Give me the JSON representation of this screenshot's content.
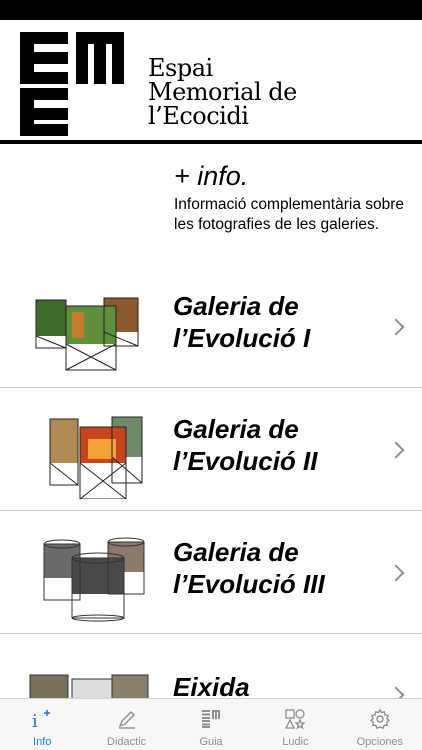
{
  "header": {
    "logo_line1": "Espai",
    "logo_line2": "Memorial de",
    "logo_line3": "l’Ecocidi"
  },
  "info": {
    "title": "+ info.",
    "description": "Informació complementària sobre les fotografies de les galeries."
  },
  "galleries": [
    {
      "title_line1": "Galeria de",
      "title_line2": "l’Evolució I"
    },
    {
      "title_line1": "Galeria de",
      "title_line2": "l’Evolució II"
    },
    {
      "title_line1": "Galeria de",
      "title_line2": "l’Evolució III"
    },
    {
      "title_line1": "Eixida",
      "title_line2": ""
    }
  ],
  "tabbar": {
    "tabs": [
      {
        "label": "Info",
        "icon": "info-plus-icon",
        "active": true
      },
      {
        "label": "Didactic",
        "icon": "pencil-icon",
        "active": false
      },
      {
        "label": "Guia",
        "icon": "eme-logo-icon",
        "active": false
      },
      {
        "label": "Ludic",
        "icon": "shapes-icon",
        "active": false
      },
      {
        "label": "Opciones",
        "icon": "gear-icon",
        "active": false
      }
    ]
  },
  "colors": {
    "accent": "#1e7cf2",
    "inactive": "#8e8e93",
    "divider": "#c8c8c8"
  }
}
